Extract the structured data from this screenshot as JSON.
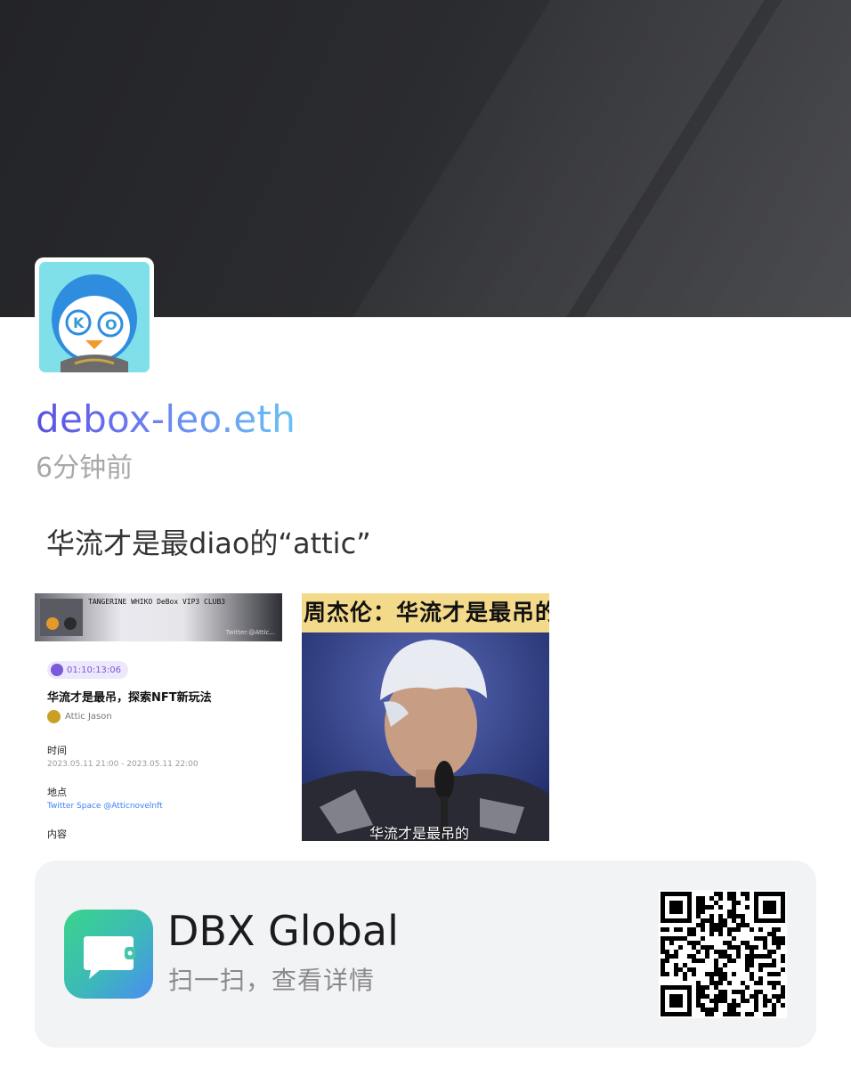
{
  "profile": {
    "username": "debox-leo.eth",
    "time_ago": "6分钟前"
  },
  "post": {
    "text": "华流才是最diao的“attic”"
  },
  "event_card": {
    "banner_text": "TANGERINE  WHIKO  DeBox  VIP3  CLUB3",
    "banner_twitter": "Twitter:@Attic...",
    "duration": "01:10:13:06",
    "title": "华流才是最吊，探索NFT新玩法",
    "host": "Attic Jason",
    "time_label": "时间",
    "time_value": "2023.05.11 21:00 - 2023.05.11 22:00",
    "place_label": "地点",
    "place_value": "Twitter Space @Atticnovelnft",
    "content_label": "内容"
  },
  "video_frame": {
    "top_caption": "周杰伦：华流才是最吊的",
    "bottom_caption": "华流才是最吊的"
  },
  "app_card": {
    "app_name": "DBX Global",
    "subtitle": "扫一扫，查看详情"
  },
  "colors": {
    "username_gradient_start": "#5a4fe0",
    "username_gradient_end": "#66c2f5",
    "app_icon_green": "#3ad58b",
    "app_icon_blue": "#4a8df2"
  }
}
